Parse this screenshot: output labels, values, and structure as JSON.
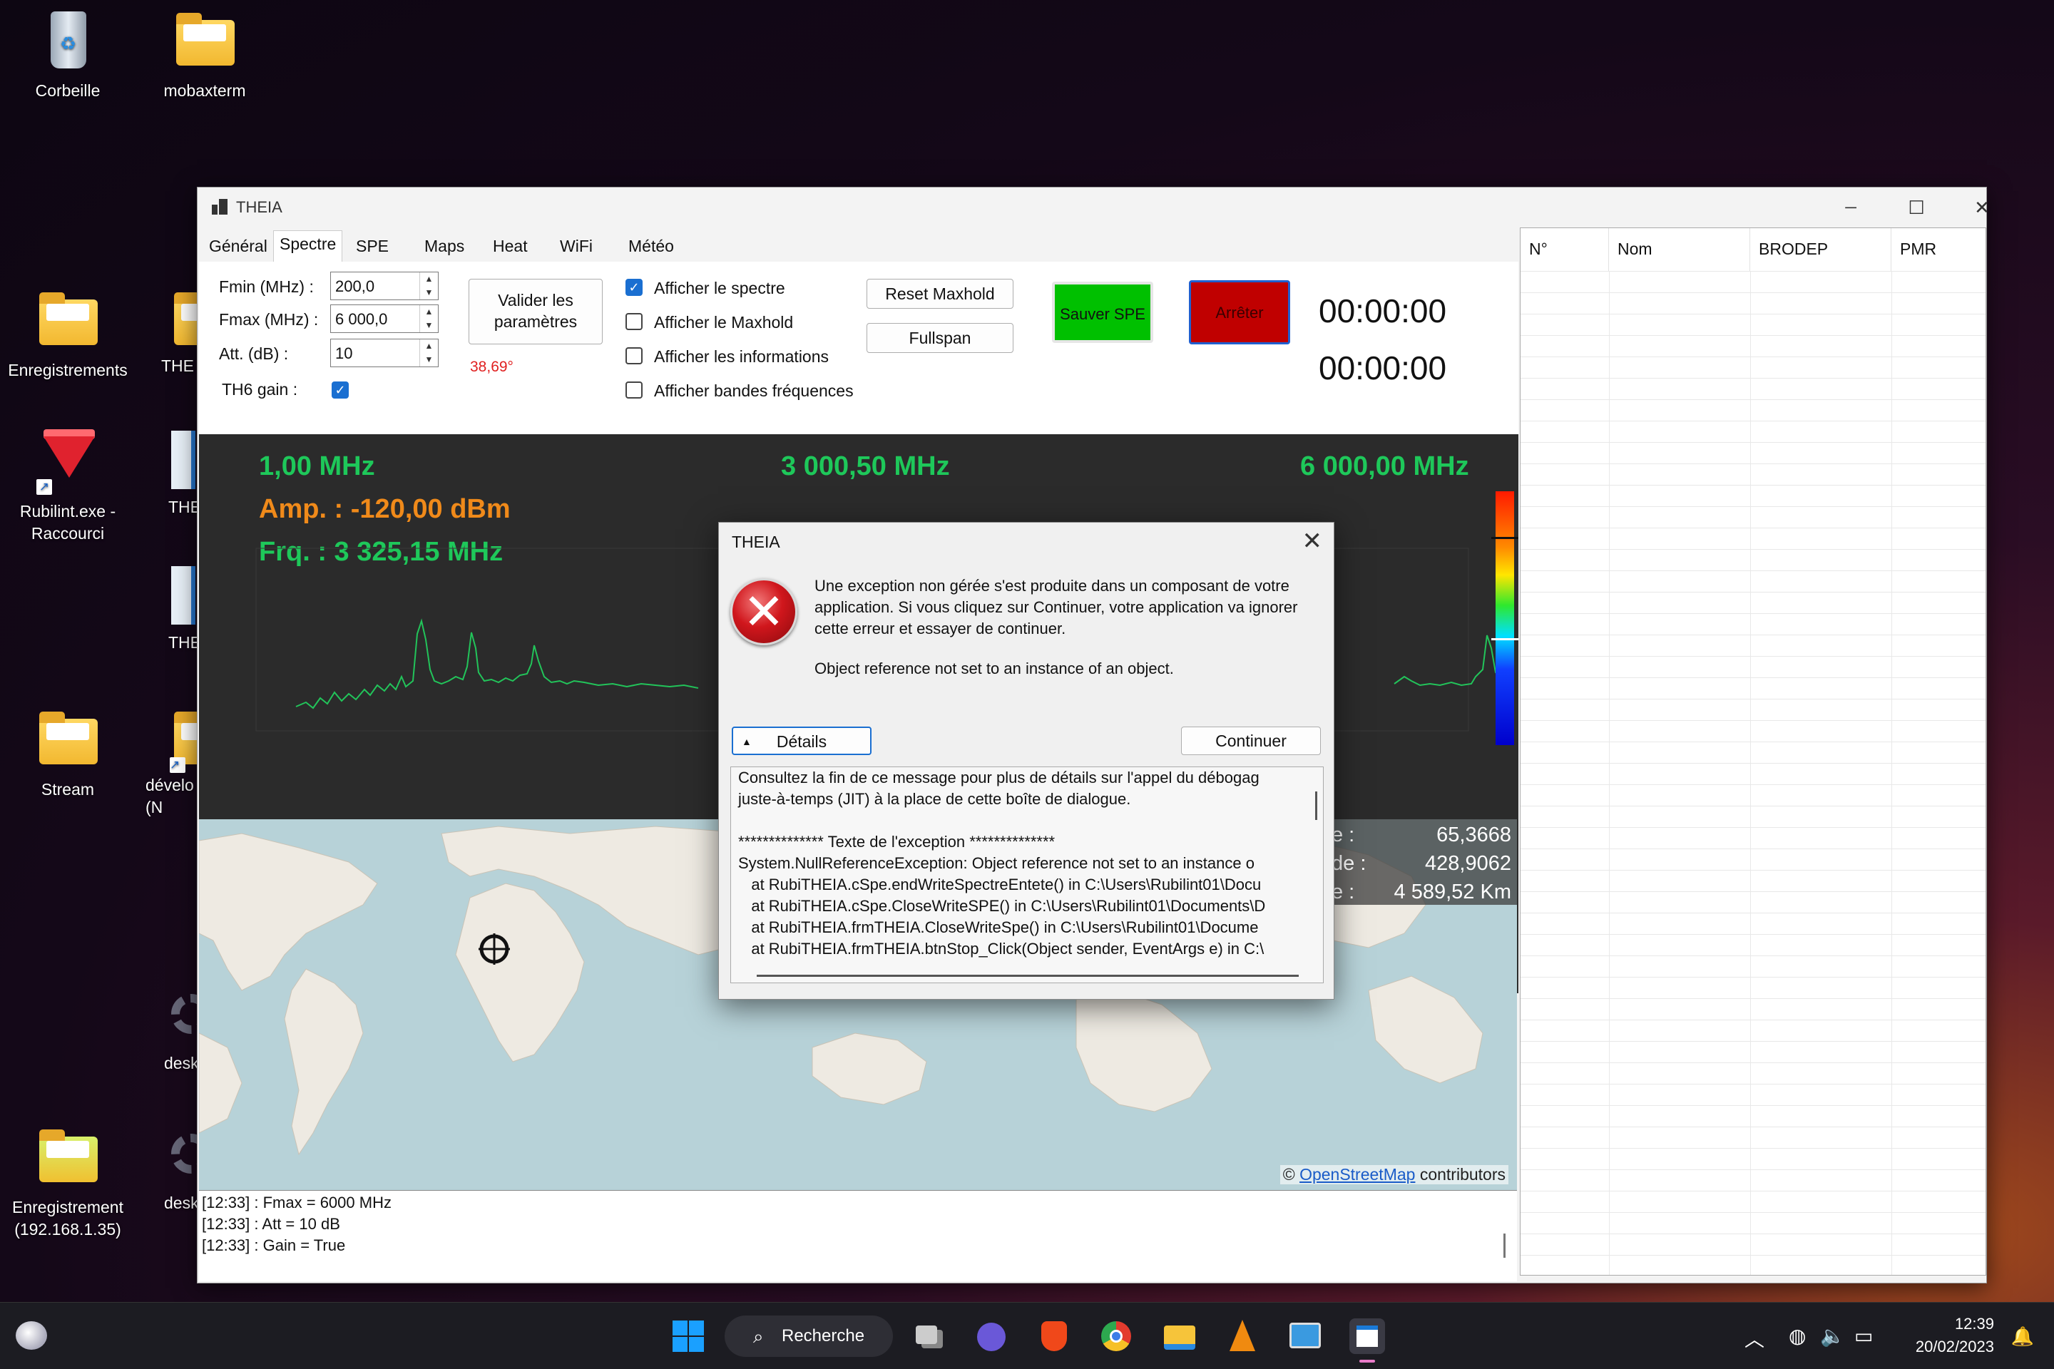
{
  "desktop": {
    "icons": [
      {
        "label": "Corbeille"
      },
      {
        "label": "mobaxterm"
      },
      {
        "label": "Enregistrements"
      },
      {
        "label": "THE"
      },
      {
        "label": "Rubilint.exe - Raccourci"
      },
      {
        "label": "THE"
      },
      {
        "label": "THE"
      },
      {
        "label": "Stream"
      },
      {
        "label": "dévelo (N"
      },
      {
        "label": "desk"
      },
      {
        "label": "Enregistrement (192.168.1.35)"
      },
      {
        "label": "desk"
      }
    ]
  },
  "window": {
    "title": "THEIA",
    "controls": {
      "minimize": "─",
      "maximize": "☐",
      "close": "✕"
    },
    "tabs": [
      "Général",
      "Spectre",
      "SPE",
      "Maps",
      "Heat",
      "WiFi",
      "Météo"
    ],
    "active_tab": "Spectre"
  },
  "params": {
    "fmin_label": "Fmin (MHz) :",
    "fmin_value": "200,0",
    "fmax_label": "Fmax (MHz) :",
    "fmax_value": "6 000,0",
    "att_label": "Att. (dB) :",
    "att_value": "10",
    "th6_label": "TH6 gain :",
    "th6_checked": true,
    "validate_button": "Valider les paramètres",
    "temperature": "38,69°"
  },
  "options": {
    "show_spectrum": "Afficher le spectre",
    "show_spectrum_checked": true,
    "show_maxhold": "Afficher le Maxhold",
    "show_maxhold_checked": false,
    "show_info": "Afficher les informations",
    "show_info_checked": false,
    "show_bands": "Afficher bandes fréquences",
    "show_bands_checked": false
  },
  "actions": {
    "reset_maxhold": "Reset Maxhold",
    "fullspan": "Fullspan",
    "save_spe": "Sauver SPE",
    "stop": "Arrêter",
    "timer1": "00:00:00",
    "timer2": "00:00:00",
    "save_color": "#00c000",
    "stop_color": "#c00000"
  },
  "spectrum": {
    "freq_left": "1,00 MHz",
    "freq_center": "3 000,50 MHz",
    "freq_right": "6 000,00 MHz",
    "amp": "Amp. : -120,00 dBm",
    "freq": "Frq. : 3 325,15 MHz",
    "green": "#1ec85a",
    "orange": "#f08a1a"
  },
  "map": {
    "info_values": [
      "65,3668",
      "428,9062",
      "4 589,52 Km"
    ],
    "info_labels": [
      "e :",
      "de :",
      "e :"
    ],
    "credit_prefix": "©",
    "credit_link": "OpenStreetMap",
    "credit_suffix": "contributors"
  },
  "log": {
    "lines": [
      "[12:33] : Fmax = 6000 MHz",
      "[12:33] : Att = 10 dB",
      "[12:33] : Gain = True"
    ]
  },
  "table": {
    "headers": [
      "N°",
      "Nom",
      "BRODEP",
      "PMR"
    ]
  },
  "dialog": {
    "title": "THEIA",
    "close": "✕",
    "message": "Une exception non gérée s'est produite dans un composant de votre application. Si vous cliquez sur Continuer, votre application va ignorer cette erreur et essayer de continuer.",
    "message2": "Object reference not set to an instance of an object.",
    "details_button": "Détails",
    "continue_button": "Continuer",
    "details_lines": [
      "Consultez la fin de ce message pour plus de détails sur l'appel du débogag",
      "juste-à-temps (JIT) à la place de cette boîte de dialogue.",
      "",
      "************** Texte de l'exception **************",
      "System.NullReferenceException: Object reference not set to an instance o",
      "   at RubiTHEIA.cSpe.endWriteSpectreEntete() in C:\\Users\\Rubilint01\\Docu",
      "   at RubiTHEIA.cSpe.CloseWriteSPE() in C:\\Users\\Rubilint01\\Documents\\D",
      "   at RubiTHEIA.frmTHEIA.CloseWriteSpe() in C:\\Users\\Rubilint01\\Docume",
      "   at RubiTHEIA.frmTHEIA.btnStop_Click(Object sender, EventArgs e) in C:\\"
    ]
  },
  "taskbar": {
    "search_label": "Recherche",
    "time": "12:39",
    "date": "20/02/2023"
  }
}
